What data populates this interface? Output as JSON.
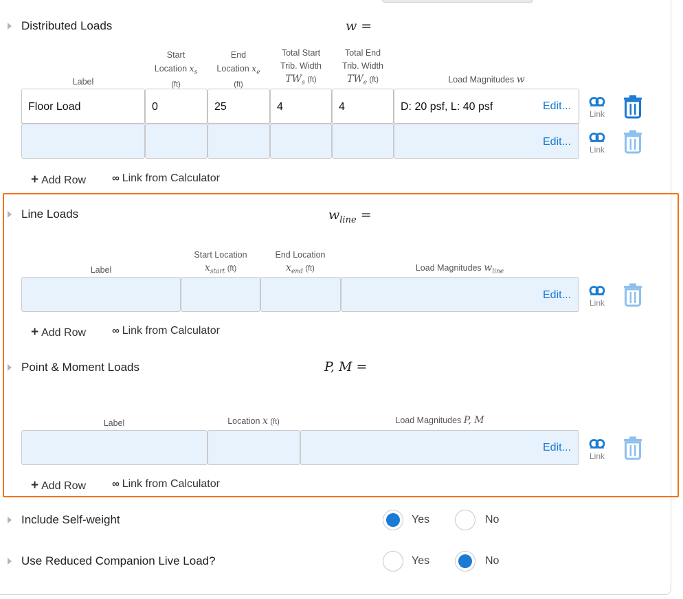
{
  "distributed": {
    "title": "Distributed Loads",
    "symbol": "w =",
    "headers": {
      "label": "Label",
      "start_1": "Start",
      "start_2": "Location",
      "start_3": "(ft)",
      "start_sym": "x",
      "start_sub": "s",
      "end_1": "End",
      "end_2": "Location",
      "end_3": "(ft)",
      "end_sym": "x",
      "end_sub": "e",
      "tws_1": "Total Start",
      "tws_2": "Trib. Width",
      "tws_sym": "TW",
      "tws_sub": "s",
      "tws_unit": "(ft)",
      "twe_1": "Total End",
      "twe_2": "Trib. Width",
      "twe_sym": "TW",
      "twe_sub": "e",
      "twe_unit": "(ft)",
      "mag": "Load Magnitudes",
      "mag_sym": "w"
    },
    "rows": [
      {
        "label": "Floor Load",
        "start": "0",
        "end": "25",
        "tws": "4",
        "twe": "4",
        "magnitudes": "D: 20 psf, L: 40 psf"
      },
      {
        "label": "",
        "start": "",
        "end": "",
        "tws": "",
        "twe": "",
        "magnitudes": ""
      }
    ]
  },
  "line": {
    "title": "Line Loads",
    "symbol": "w",
    "symbol_sub": "line",
    "symbol_eq": "=",
    "headers": {
      "label": "Label",
      "start_1": "Start Location",
      "start_sym": "x",
      "start_sub": "start",
      "start_unit": "(ft)",
      "end_1": "End Location",
      "end_sym": "x",
      "end_sub": "end",
      "end_unit": "(ft)",
      "mag": "Load Magnitudes",
      "mag_sym": "w",
      "mag_sub": "line"
    }
  },
  "point": {
    "title": "Point & Moment Loads",
    "symbol": "P, M =",
    "headers": {
      "label": "Label",
      "loc": "Location",
      "loc_sym": "x",
      "loc_unit": "(ft)",
      "mag": "Load Magnitudes",
      "mag_sym": "P, M"
    }
  },
  "common": {
    "edit": "Edit...",
    "link": "Link",
    "add_row": "Add Row",
    "link_calc": "Link from Calculator",
    "yes": "Yes",
    "no": "No"
  },
  "self_weight": {
    "label": "Include Self-weight",
    "selected": "Yes"
  },
  "reduced_live": {
    "label": "Use Reduced Companion Live Load?",
    "selected": "No"
  },
  "colors": {
    "accent": "#1a7ad4",
    "highlight": "#f47216",
    "empty_cell": "#e7f2fd"
  }
}
